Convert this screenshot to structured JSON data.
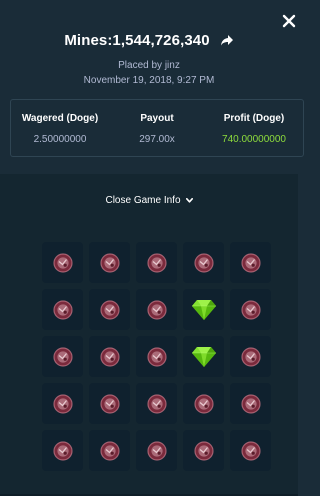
{
  "header": {
    "title": "Mines:1,544,726,340",
    "placed_by": "Placed by jinz",
    "date": "November 19, 2018, 9:27 PM"
  },
  "stats": [
    {
      "label": "Wagered (Doge)",
      "value": "2.50000000"
    },
    {
      "label": "Payout",
      "value": "297.00x"
    },
    {
      "label": "Profit (Doge)",
      "value": "740.00000000"
    }
  ],
  "toggle": {
    "label": "Close Game Info"
  },
  "board": {
    "rows": 5,
    "cols": 5,
    "cells": [
      [
        "mine",
        "mine",
        "mine",
        "mine",
        "mine"
      ],
      [
        "mine",
        "mine",
        "mine",
        "gem",
        "mine"
      ],
      [
        "mine",
        "mine",
        "mine",
        "gem",
        "mine"
      ],
      [
        "mine",
        "mine",
        "mine",
        "mine",
        "mine"
      ],
      [
        "mine",
        "mine",
        "mine",
        "mine",
        "mine"
      ]
    ]
  },
  "colors": {
    "background": "#1a2c38",
    "board_background": "#142630",
    "tile": "#0f212e",
    "profit": "#8edd3c",
    "muted_text": "#b1bad3",
    "gem": "#6fd41a",
    "mine": "#7a2a3c"
  },
  "icons": {
    "close": "close-icon",
    "share": "share-icon",
    "toggle": "chevron-down-icon"
  }
}
